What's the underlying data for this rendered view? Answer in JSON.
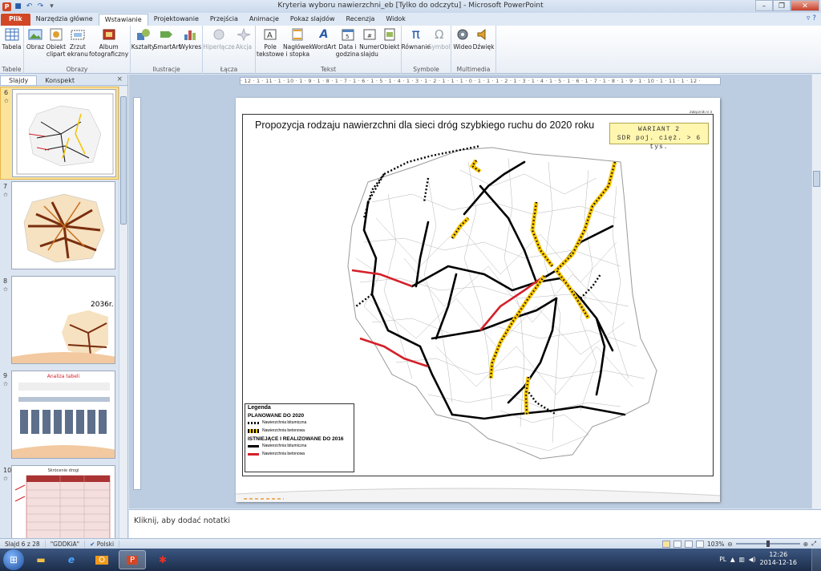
{
  "window": {
    "title": "Kryteria wyboru nawierzchni_eb [Tylko do odczytu] - Microsoft PowerPoint",
    "buttons": {
      "minimize": "–",
      "maximize": "❐",
      "close": "✕"
    }
  },
  "tabs": [
    "Plik",
    "Narzędzia główne",
    "Wstawianie",
    "Projektowanie",
    "Przejścia",
    "Animacje",
    "Pokaz slajdów",
    "Recenzja",
    "Widok"
  ],
  "ribbon": {
    "groups": [
      {
        "label": "Tabele",
        "buttons": [
          "Tabela"
        ]
      },
      {
        "label": "Obrazy",
        "buttons": [
          "Obraz",
          "Obiekt\nclipart",
          "Zrzut\nekranu",
          "Album\nfotograficzny"
        ]
      },
      {
        "label": "Ilustracje",
        "buttons": [
          "Kształty",
          "SmartArt",
          "Wykres"
        ]
      },
      {
        "label": "Łącza",
        "buttons": [
          "Hiperłącze",
          "Akcja"
        ]
      },
      {
        "label": "Tekst",
        "buttons": [
          "Pole\ntekstowe",
          "Nagłówek\ni stopka",
          "WordArt",
          "Data i\ngodzina",
          "Numer\nslajdu",
          "Obiekt"
        ]
      },
      {
        "label": "Symbole",
        "buttons": [
          "Równanie",
          "Symbol"
        ]
      },
      {
        "label": "Multimedia",
        "buttons": [
          "Wideo",
          "Dźwięk"
        ]
      }
    ]
  },
  "left_pane": {
    "tabs": [
      "Slajdy",
      "Konspekt"
    ],
    "close": "×",
    "slides": [
      {
        "number": "6",
        "selected": true
      },
      {
        "number": "7"
      },
      {
        "number": "8",
        "label": "2036r."
      },
      {
        "number": "9",
        "label": "Analiza tabeli"
      },
      {
        "number": "10",
        "label": "Skrócenie drogi"
      }
    ]
  },
  "ruler": "· 12 · 1 · 11 · 1 · 10 · 1 · 9 · 1 · 8 · 1 · 7 · 1 · 6 · 1 · 5 · 1 · 4 · 1 · 3 · 1 · 2 · 1 · 1 · 1 · 0 · 1 · 1 · 1 · 2 · 1 · 3 · 1 · 4 · 1 · 5 · 1 · 6 · 1 · 7 · 1 · 8 · 1 · 9 · 1 · 10 · 1 · 11 · 1 · 12 ·",
  "slide": {
    "attachment": "Załącznik nr 3",
    "title": "Propozycja rodzaju nawierzchni dla sieci dróg szybkiego ruchu do 2020 roku",
    "variant_line1": "WARIANT 2",
    "variant_line2": "SDR poj. cięż. > 6 tys.",
    "legend": {
      "title": "Legenda",
      "section1": "PLANOWANE DO 2020",
      "item1": "Nawierzchnia bitumiczna",
      "item2": "Nawierzchnia betonowa",
      "section2": "ISTNIEJĄCE I REALIZOWANE DO 2016",
      "item3": "Nawierzchnia bitumiczna",
      "item4": "Nawierzchnia betonowa"
    }
  },
  "notes_placeholder": "Kliknij, aby dodać notatki",
  "statusbar": {
    "slide_info": "Slajd 6 z 28",
    "theme": "\"GDDKiA\"",
    "language": "Polski",
    "zoom": "103%"
  },
  "taskbar": {
    "lang": "PL",
    "time": "12:26",
    "date": "2014-12-16"
  },
  "colors": {
    "file_tab": "#d24726",
    "bitumen": "#000000",
    "concrete_planned": "#f5c400",
    "concrete_existing": "#d4202a"
  }
}
